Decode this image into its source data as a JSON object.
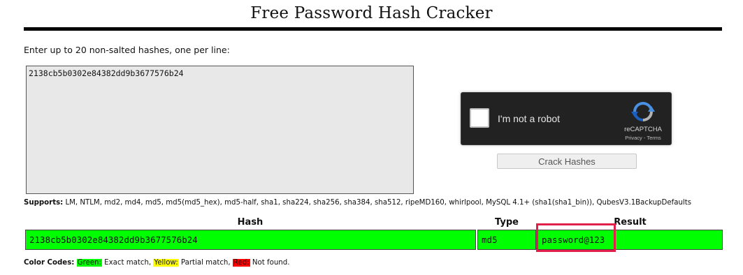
{
  "page": {
    "title": "Free Password Hash Cracker"
  },
  "form": {
    "instructions": "Enter up to 20 non-salted hashes, one per line:",
    "textarea_value": "2138cb5b0302e84382dd9b3677576b24"
  },
  "captcha": {
    "checkbox_label": "I'm not a robot",
    "brand": "reCAPTCHA",
    "privacy_link": "Privacy",
    "separator": " - ",
    "terms_link": "Terms",
    "icon": "recaptcha-logo-icon",
    "colors": {
      "background": "#222222",
      "label": "#e6e6e6",
      "logo_blue": "#4a90e2",
      "logo_gray": "#b3b3b3"
    }
  },
  "actions": {
    "crack_button_label": "Crack Hashes"
  },
  "supports": {
    "label": "Supports:",
    "list": "LM, NTLM, md2, md4, md5, md5(md5_hex), md5-half, sha1, sha224, sha256, sha384, sha512, ripeMD160, whirlpool, MySQL 4.1+ (sha1(sha1_bin)), QubesV3.1BackupDefaults"
  },
  "results": {
    "columns": [
      "Hash",
      "Type",
      "Result"
    ],
    "rows": [
      {
        "hash": "2138cb5b0302e84382dd9b3677576b24",
        "type": "md5",
        "result": "password@123",
        "status": "exact-match"
      }
    ],
    "highlight_color": "#e0224b",
    "match_color": "#00ff00"
  },
  "legend": {
    "label": "Color Codes:",
    "green_label": "Green:",
    "green_text": "Exact match,",
    "yellow_label": "Yellow:",
    "yellow_text": "Partial match,",
    "red_label": "Red:",
    "red_text": "Not found.",
    "colors": {
      "green": "#00ff00",
      "yellow": "#ffff00",
      "red": "#ff0000"
    }
  }
}
